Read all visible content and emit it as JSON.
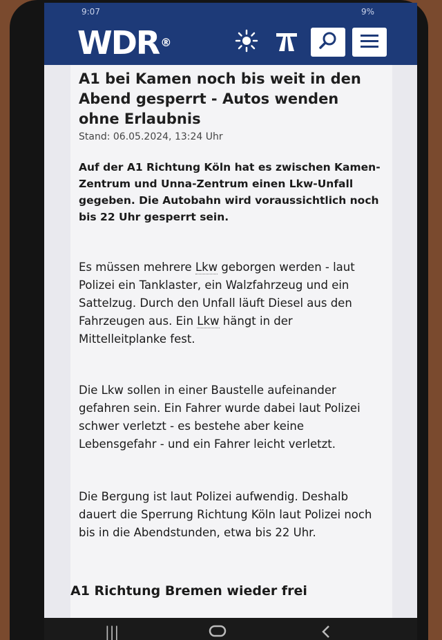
{
  "status_bar": {
    "time": "9:07",
    "battery": "9%"
  },
  "header": {
    "logo": "WDR",
    "logo_mark": "®",
    "icons": [
      "sun-icon",
      "highway-icon",
      "search-icon",
      "menu-icon"
    ]
  },
  "article": {
    "headline": "A1 bei Kamen noch bis weit in den Abend gesperrt - Autos wenden ohne Erlaubnis",
    "stand": "Stand: 06.05.2024, 13:24 Uhr",
    "lead": "Auf der A1 Richtung Köln hat es zwischen Kamen-Zentrum und Unna-Zentrum einen Lkw-Unfall gegeben. Die Autobahn wird voraussichtlich noch bis 22 Uhr gesperrt sein.",
    "p1_a": "Es müssen mehrere ",
    "p1_lkw1": "Lkw",
    "p1_b": " geborgen werden - laut Polizei ein Tanklaster, ein Walzfahrzeug und ein Sattelzug. Durch den Unfall läuft Diesel aus den Fahrzeugen aus. Ein ",
    "p1_lkw2": "Lkw",
    "p1_c": " hängt in der Mittelleitplanke fest.",
    "p2": "Die Lkw sollen in einer Baustelle aufeinander gefahren sein. Ein Fahrer wurde dabei laut Polizei schwer verletzt - es bestehe aber keine Lebensgefahr - und ein Fahrer leicht verletzt.",
    "p3": "Die Bergung ist laut Polizei aufwendig. Deshalb dauert die Sperrung Richtung Köln laut Polizei noch bis in die Abendstunden, etwa bis 22 Uhr.",
    "subhead": "A1 Richtung Bremen wieder frei"
  },
  "colors": {
    "header_bg": "#1d3a78",
    "page_bg": "#f4f4f6",
    "text": "#1a1a1a"
  }
}
